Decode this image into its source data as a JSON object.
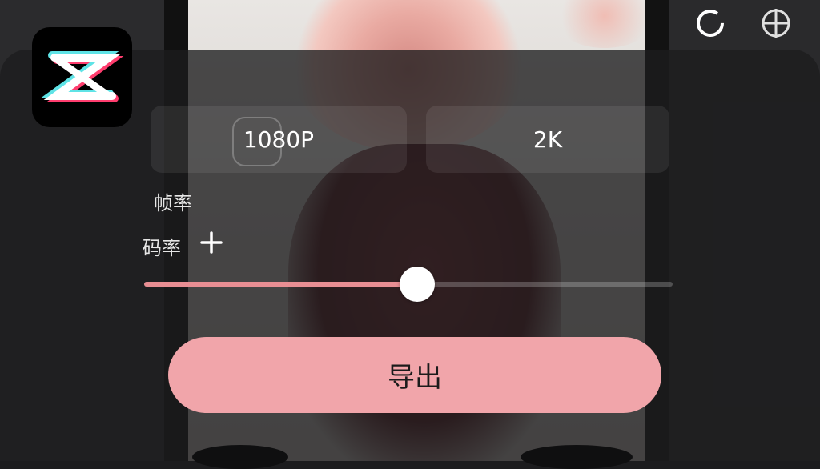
{
  "app": {
    "logo_icon": "capcut-logo-icon"
  },
  "top_icons": [
    "refresh-circle-icon",
    "crosshair-target-icon"
  ],
  "export_settings": {
    "resolution_options": [
      {
        "label": "1080P",
        "selected": false
      },
      {
        "label": "2K",
        "selected": false
      }
    ],
    "frame_rate_label": "帧率",
    "bitrate_label": "码率",
    "bitrate_slider": {
      "value_fraction": 0.516,
      "accent_color": "#e88e93"
    }
  },
  "export_button": {
    "label": "导出",
    "color": "#f1a5aa"
  },
  "colors": {
    "panel_bg": "#1c1c1e",
    "accent": "#e88e93"
  }
}
